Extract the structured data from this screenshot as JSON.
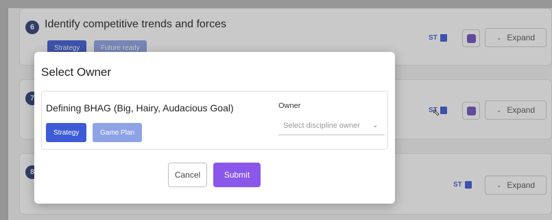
{
  "tasks": [
    {
      "number": "6",
      "title": "Identify competitive trends and forces",
      "tags": [
        "Strategy",
        "Future ready"
      ],
      "st_label": "ST",
      "expand_label": "Expand"
    },
    {
      "number": "7",
      "st_label": "ST",
      "expand_label": "Expand"
    },
    {
      "number": "8",
      "st_label": "ST",
      "expand_label": "Expand"
    }
  ],
  "modal": {
    "title": "Select Owner",
    "goal": {
      "title": "Defining BHAG (Big, Hairy, Audacious Goal)",
      "tags": [
        "Strategy",
        "Game Plan"
      ],
      "owner_label": "Owner",
      "owner_placeholder": "Select discipline owner"
    },
    "cancel_label": "Cancel",
    "submit_label": "Submit"
  },
  "colors": {
    "accent": "#3d5bd6",
    "submit": "#8a57ea",
    "badge": "#2a3d78"
  }
}
